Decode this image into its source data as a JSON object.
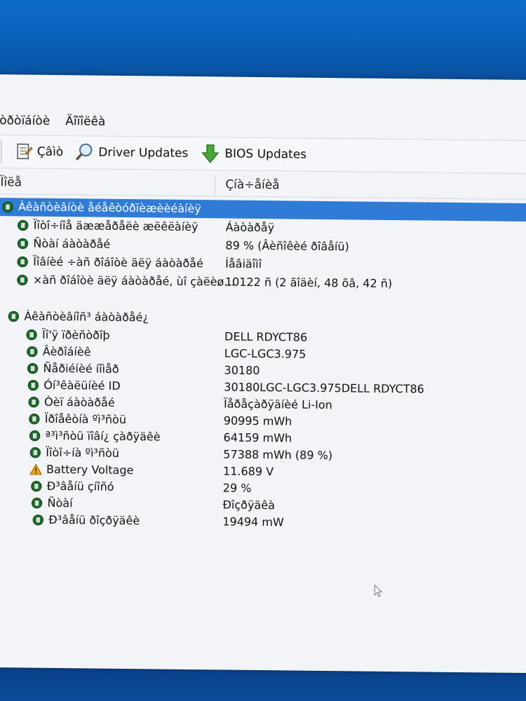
{
  "menu": {
    "item1": "òðòïáíòè",
    "item2": "Äîïîëêà"
  },
  "toolbar": {
    "btn1": "Çâìò",
    "btn2": "Driver Updates",
    "btn3": "BIOS Updates"
  },
  "columns": {
    "name": "Ïîëå",
    "value": "Çíà÷åíèå"
  },
  "section1": {
    "title": "Àêàñòèâíòè åéåêòóðïèæèèéàíèÿ",
    "rows": [
      {
        "label": "Ïîòî÷íîå äææåðåëè æëêëàíèÿ",
        "value": "Áàòàðåÿ"
      },
      {
        "label": "Ñòàí áàòàðåé",
        "value": "89 % (Âèñîêèé ðîâåíü)"
      },
      {
        "label": "Ïîâíèé ÷àñ ðîáîòè äëÿ áàòàðåé",
        "value": "Íåâiäîìî"
      },
      {
        "label": "×àñ ðîáîòè äëÿ áàòàðåé, ùî çàëèø...",
        "value": "10122 ñ (2 ãîäèí, 48 õâ, 42 ñ)"
      }
    ]
  },
  "section2": {
    "title": "Àêàñòèâíîñ³ áàòàðåé¿",
    "rows": [
      {
        "label": "Ïî'ÿ ïðèñòðîþ",
        "value": "DELL RDYCT86",
        "icon": "battery"
      },
      {
        "label": "Âèðîáíèê",
        "value": "LGC-LGC3.975",
        "icon": "battery"
      },
      {
        "label": "Ñåðiéíèé íîìåð",
        "value": "30180",
        "icon": "battery"
      },
      {
        "label": "Óí³êàëüíèé ID",
        "value": "30180LGC-LGC3.975DELL RDYCT86",
        "icon": "battery"
      },
      {
        "label": "Òèï áàòàðåé",
        "value": "Ïåðåçàðÿäíèé Li-Ion",
        "icon": "battery"
      },
      {
        "label": "Ïðîåêòíà ºì³ñòü",
        "value": "90995 mWh",
        "icon": "battery"
      },
      {
        "label": "ª³ì³ñòü ïîâí¿ çàðÿäêè",
        "value": "64159 mWh",
        "icon": "battery"
      },
      {
        "label": "Ïîòî÷íà ºì³ñòü",
        "value": "57388 mWh  (89 %)",
        "icon": "battery"
      },
      {
        "label": "Battery Voltage",
        "value": "11.689 V",
        "icon": "warning"
      },
      {
        "label": "Ð³âåíü çíîñó",
        "value": "29 %",
        "icon": "battery"
      },
      {
        "label": "Ñòàí",
        "value": "Ðîçðÿäêà",
        "icon": "battery"
      },
      {
        "label": "Ð³âåíü ðîçðÿäêè",
        "value": "19494 mW",
        "icon": "battery"
      }
    ]
  }
}
